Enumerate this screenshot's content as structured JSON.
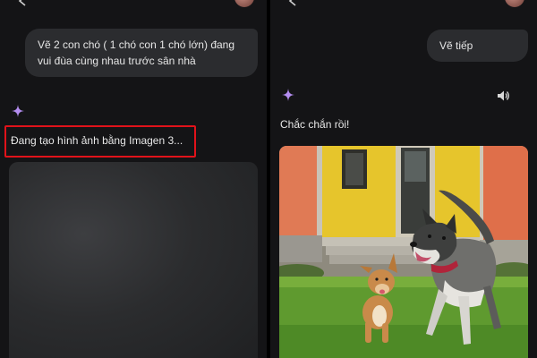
{
  "left_panel": {
    "prompt_text": "Vẽ 2 con chó ( 1 chó con 1 chó lớn) đang vui đùa cùng nhau trước sân nhà",
    "status_text": "Đang tạo hình ảnh bằng Imagen 3..."
  },
  "right_panel": {
    "prompt_text": "Vẽ tiếp",
    "reply_text": "Chắc chắn rồi!"
  },
  "icons": {
    "assistant": "sparkle-icon",
    "audio": "speaker-icon",
    "back": "back-arrow-icon"
  },
  "colors": {
    "background": "#141416",
    "bubble": "#2b2c2f",
    "highlight_border": "#e1121a",
    "sparkle": "#b48df0"
  }
}
